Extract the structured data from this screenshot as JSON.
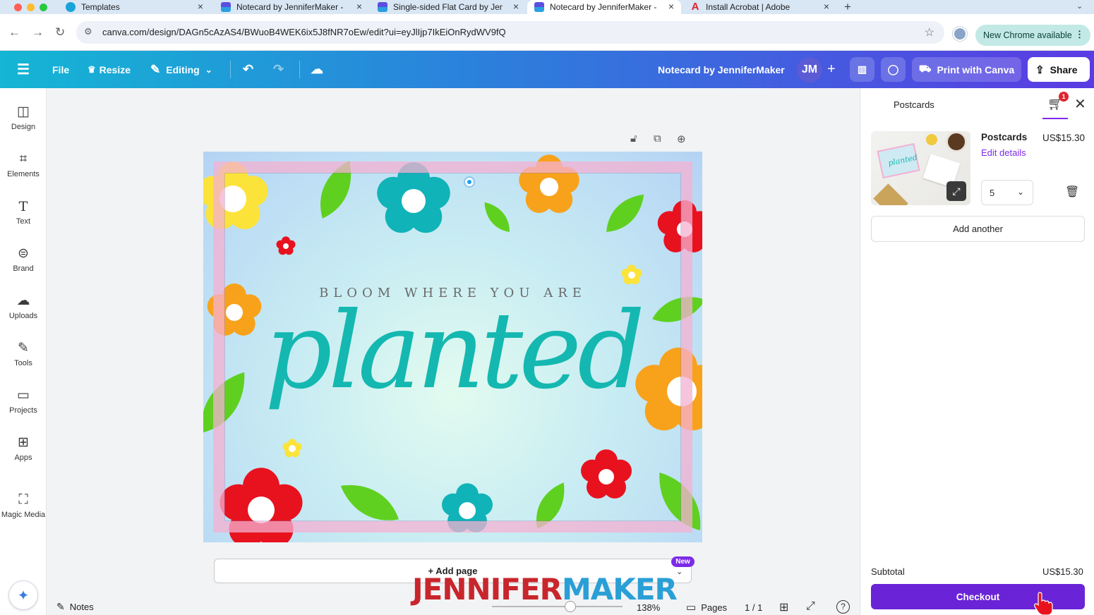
{
  "browser": {
    "tabs": [
      {
        "title": "Templates",
        "active": false
      },
      {
        "title": "Notecard by JenniferMaker -",
        "active": false
      },
      {
        "title": "Single-sided Flat Card by Jen",
        "active": false
      },
      {
        "title": "Notecard by JenniferMaker -",
        "active": true
      },
      {
        "title": "Install Acrobat | Adobe",
        "active": false
      }
    ],
    "new_tab_icon": "plus-icon",
    "url": "canva.com/design/DAGn5cAzAS4/BWuoB4WEK6ix5J8fNR7oEw/edit?ui=eyJlIjp7IkEiOnRydWV9fQ",
    "update_label": "New Chrome available"
  },
  "toolbar": {
    "file": "File",
    "resize": "Resize",
    "editing": "Editing",
    "design_title": "Notecard by JenniferMaker",
    "avatar_initials": "JM",
    "print_label": "Print with Canva",
    "share_label": "Share",
    "colors": {
      "gradient_start": "#14b6d4",
      "gradient_end": "#5b3be3"
    }
  },
  "sidebar": {
    "items": [
      {
        "label": "Design",
        "icon": "layout-icon"
      },
      {
        "label": "Elements",
        "icon": "shapes-icon"
      },
      {
        "label": "Text",
        "icon": "text-icon"
      },
      {
        "label": "Brand",
        "icon": "brand-icon"
      },
      {
        "label": "Uploads",
        "icon": "cloud-upload-icon"
      },
      {
        "label": "Tools",
        "icon": "pen-icon"
      },
      {
        "label": "Projects",
        "icon": "folder-icon"
      },
      {
        "label": "Apps",
        "icon": "apps-icon"
      },
      {
        "label": "Magic Media",
        "icon": "magic-media-icon"
      }
    ]
  },
  "canvas": {
    "tagline": "BLOOM WHERE YOU ARE",
    "headline": "planted",
    "add_page": "+ Add page",
    "new_badge": "New"
  },
  "bottom_bar": {
    "notes": "Notes",
    "zoom": "138%",
    "zoom_level": 0.6,
    "pages": "Pages",
    "page_count": "1 / 1"
  },
  "watermark": {
    "part1": "JENNIFER",
    "part2": "MAKER"
  },
  "cart": {
    "title": "Postcards",
    "badge_count": "1",
    "product_name": "Postcards",
    "product_price": "US$15.30",
    "edit_details": "Edit details",
    "quantity": "5",
    "add_another": "Add another",
    "subtotal_label": "Subtotal",
    "subtotal_value": "US$15.30",
    "checkout": "Checkout",
    "accent_color": "#6a23d6"
  }
}
